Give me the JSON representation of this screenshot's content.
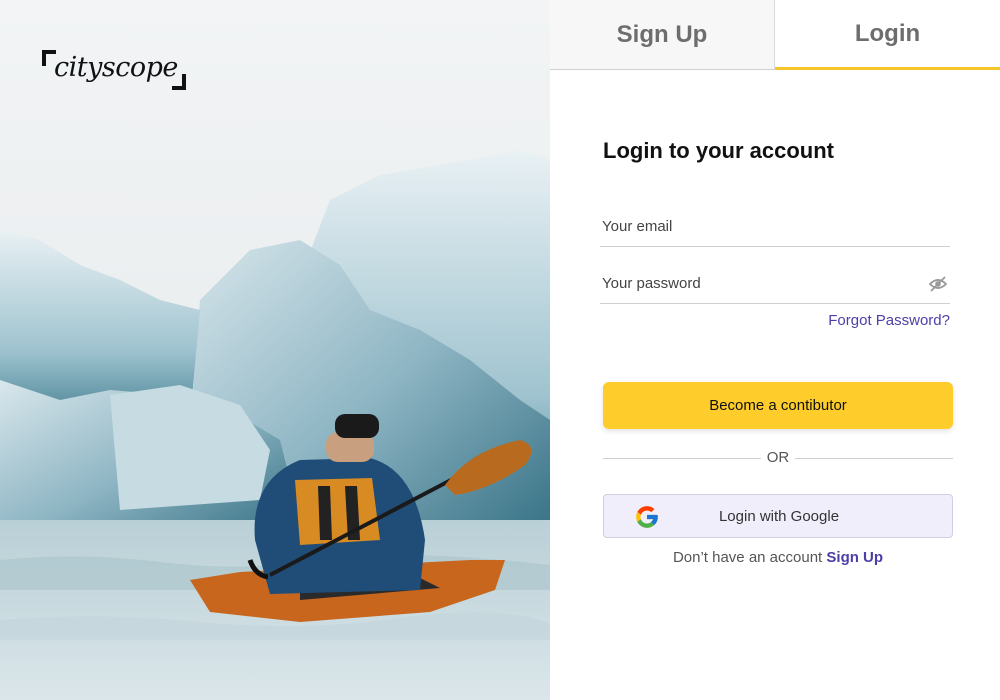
{
  "brand": {
    "logo_text": "cityscope"
  },
  "tabs": [
    {
      "label": "Sign Up",
      "active": false
    },
    {
      "label": "Login",
      "active": true
    }
  ],
  "form": {
    "title": "Login to your account",
    "email_placeholder": "Your email",
    "password_placeholder": "Your password",
    "forgot_label": "Forgot Password?",
    "primary_button": "Become a contibutor",
    "divider_text": "OR",
    "google_button": "Login with Google",
    "signup_prompt": "Don’t have an account",
    "signup_link": "Sign Up"
  },
  "icons": {
    "password_toggle": "eye-off-icon",
    "google": "google-icon"
  },
  "colors": {
    "accent": "#fecd2c",
    "link": "#4b3fa8",
    "google_button_bg": "#f1eefc",
    "tab_indicator": "#f6c52a"
  }
}
